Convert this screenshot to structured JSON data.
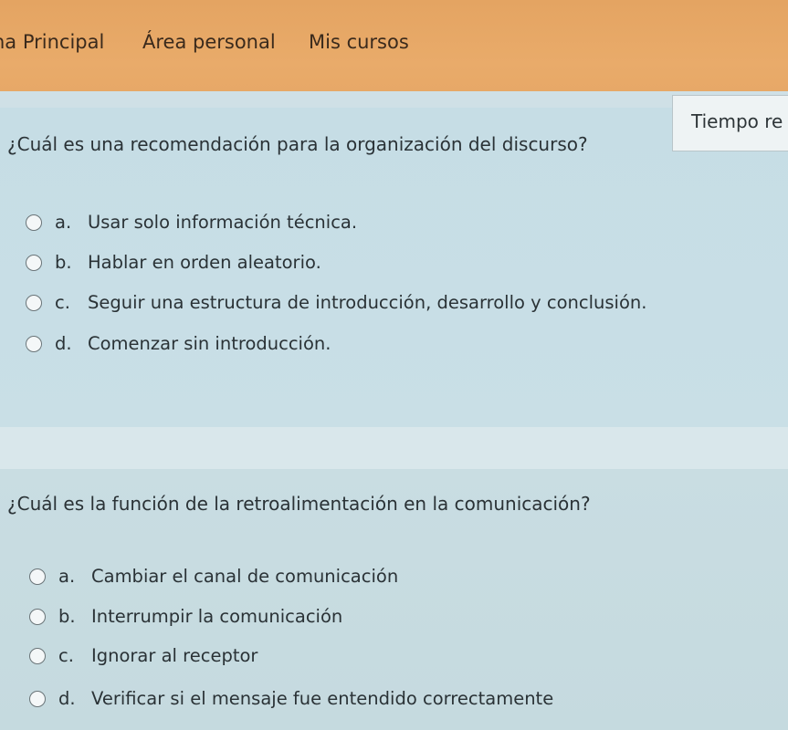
{
  "nav": {
    "home": "na Principal",
    "area": "Área personal",
    "courses": "Mis cursos"
  },
  "timer": {
    "label": "Tiempo re"
  },
  "questions": [
    {
      "text": "¿Cuál es una recomendación para la organización del discurso?",
      "answers": [
        {
          "letter": "a.",
          "text": "Usar solo información técnica."
        },
        {
          "letter": "b.",
          "text": "Hablar en orden aleatorio."
        },
        {
          "letter": "c.",
          "text": "Seguir una estructura de introducción, desarrollo y conclusión."
        },
        {
          "letter": "d.",
          "text": "Comenzar sin introducción."
        }
      ]
    },
    {
      "text": "¿Cuál es la función de la retroalimentación en la comunicación?",
      "answers": [
        {
          "letter": "a.",
          "text": "Cambiar el canal de comunicación"
        },
        {
          "letter": "b.",
          "text": "Interrumpir la comunicación"
        },
        {
          "letter": "c.",
          "text": "Ignorar al receptor"
        },
        {
          "letter": "d.",
          "text": "Verificar si el mensaje fue entendido correctamente"
        }
      ]
    }
  ]
}
